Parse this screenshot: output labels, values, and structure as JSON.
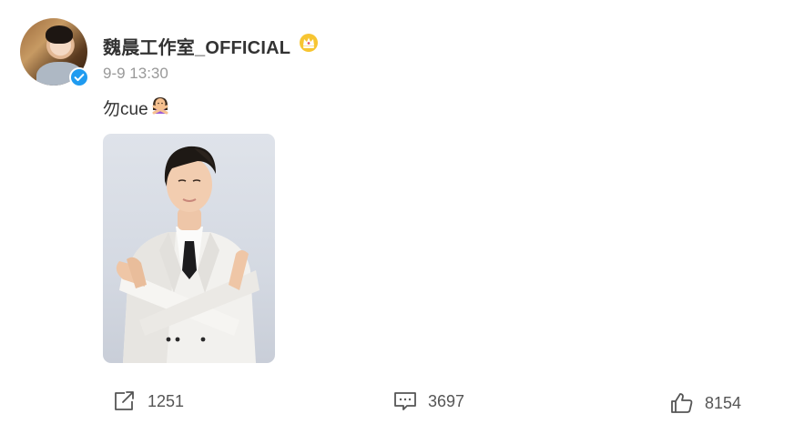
{
  "post": {
    "author": {
      "name": "魏晨工作室_OFFICIAL",
      "badge_icon": "crown-icon",
      "verified_icon": "verified-icon",
      "verified_color": "#1f9bf0"
    },
    "timestamp": "9-9 13:30",
    "text": "勿cue",
    "text_emoji_icon": "person-gesturing-no-icon",
    "image": {
      "description_icon": "photo-man-white-suit-crossed-arms"
    },
    "actions": {
      "repost_count": "1251",
      "comment_count": "3697",
      "like_count": "8154"
    }
  },
  "colors": {
    "text_primary": "#333333",
    "text_secondary": "#999999",
    "action_icon": "#555555",
    "background": "#ffffff"
  }
}
